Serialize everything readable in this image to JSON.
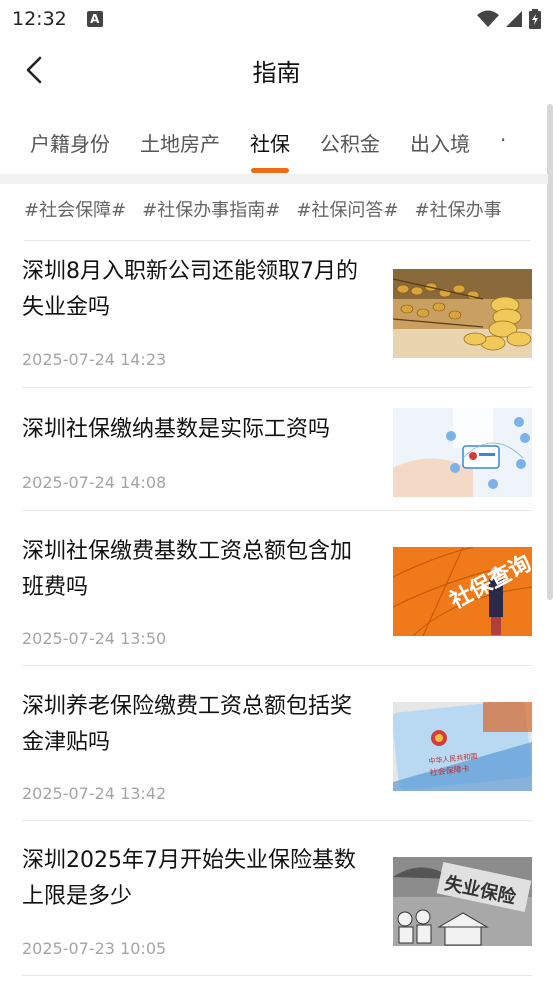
{
  "status_bar": {
    "time": "12:32",
    "notification_icon": "A",
    "icons": [
      "wifi-icon",
      "signal-icon",
      "battery-icon"
    ]
  },
  "nav": {
    "title": "指南",
    "back_icon": "chevron-left-icon"
  },
  "tabs": [
    {
      "label": "户籍身份",
      "active": false
    },
    {
      "label": "土地房产",
      "active": false
    },
    {
      "label": "社保",
      "active": true
    },
    {
      "label": "公积金",
      "active": false
    },
    {
      "label": "出入境",
      "active": false
    },
    {
      "label": "·",
      "active": false
    }
  ],
  "accent_color": "#f06a14",
  "tags": [
    "#社会保障#",
    "#社保办事指南#",
    "#社保问答#",
    "#社保办事"
  ],
  "articles": [
    {
      "title": "深圳8月入职新公司还能领取7月的失业金吗",
      "date": "2025-07-24 14:23",
      "thumb": "gold-abacus-coins"
    },
    {
      "title": "深圳社保缴纳基数是实际工资吗",
      "date": "2025-07-24 14:08",
      "thumb": "hand-digital-card"
    },
    {
      "title": "深圳社保缴费基数工资总额包含加班费吗",
      "date": "2025-07-24 13:50",
      "thumb": "orange-banner",
      "thumb_text": "社保查询"
    },
    {
      "title": "深圳养老保险缴费工资总额包括奖金津贴吗",
      "date": "2025-07-24 13:42",
      "thumb": "social-security-card",
      "thumb_text": "中华人民共和国",
      "thumb_text2": "社会保障卡"
    },
    {
      "title": "深圳2025年7月开始失业保险基数上限是多少",
      "date": "2025-07-23 10:05",
      "thumb": "unemployment-insurance",
      "thumb_text": "失业保险"
    }
  ]
}
